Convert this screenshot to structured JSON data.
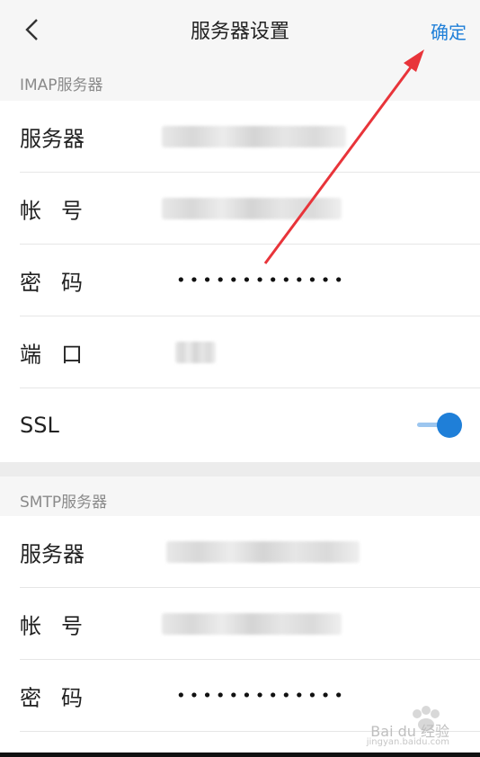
{
  "header": {
    "title": "服务器设置",
    "confirm_label": "确定"
  },
  "imap": {
    "section_label": "IMAP服务器",
    "server_label": "服务器",
    "account_label": "帐号",
    "password_label": "密码",
    "password_dots": "•••••••••••••",
    "port_label": "端口",
    "ssl_label": "SSL",
    "ssl_enabled": true
  },
  "smtp": {
    "section_label": "SMTP服务器",
    "server_label": "服务器",
    "account_label": "帐号",
    "password_label": "密码",
    "password_dots": "•••••••••••••"
  },
  "watermark": {
    "brand": "Bai du 经验",
    "url": "jingyan.baidu.com"
  },
  "colors": {
    "accent": "#1f7fd8",
    "arrow": "#e8343a"
  }
}
